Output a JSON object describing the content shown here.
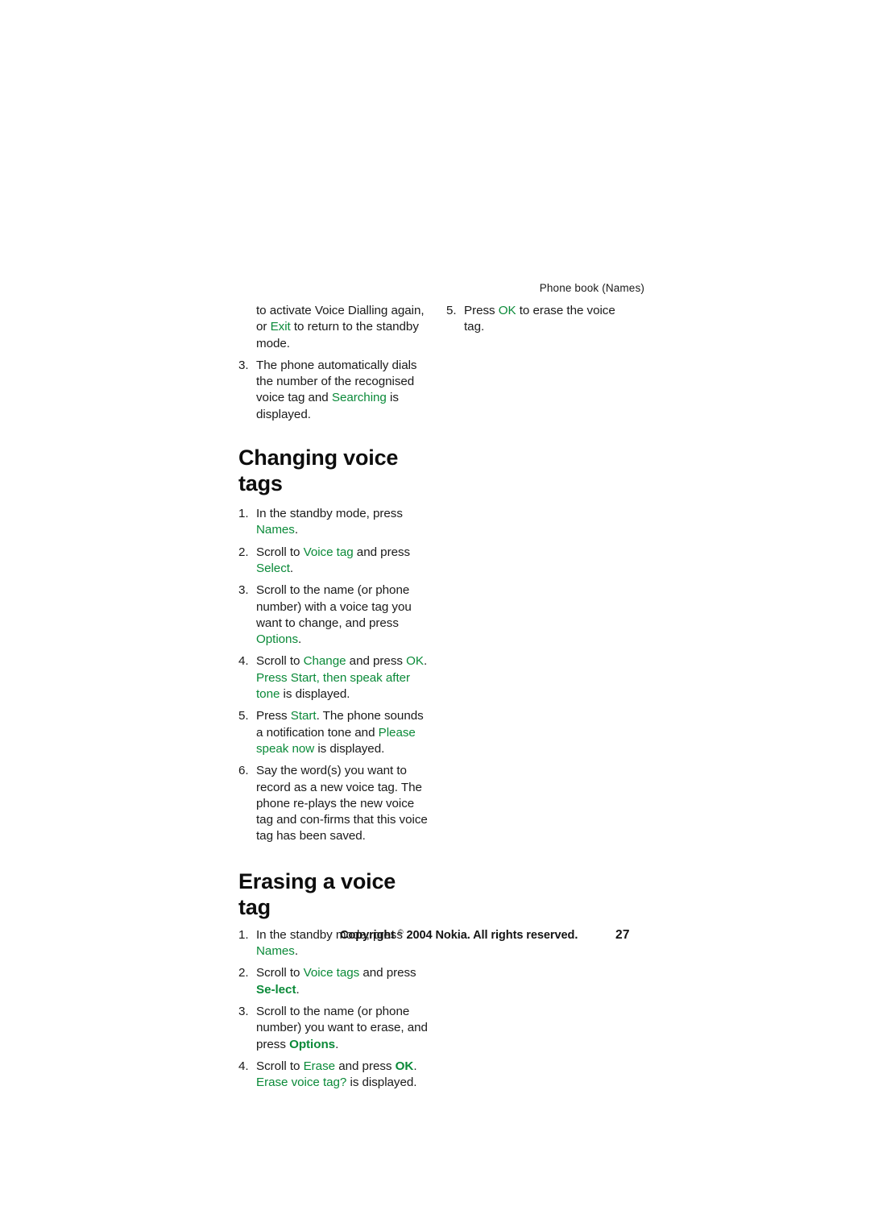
{
  "document": {
    "running_header": "Phone book (Names)",
    "page_number": "27"
  },
  "footer": {
    "copyright_prefix": "Copyright ",
    "copyright_symbol": "©",
    "copyright_suffix": " 2004 Nokia. All rights reserved."
  },
  "left_column": {
    "continuation": {
      "part1": "to activate Voice Dialling again, or ",
      "ui1": "Exit",
      "part2": " to return to the standby mode."
    },
    "step3": {
      "num": "3.",
      "part1": "The phone automatically dials the number of the recognised voice tag and ",
      "ui1": "Searching",
      "part2": " is displayed."
    },
    "sections": [
      {
        "heading": "Changing voice tags",
        "steps": [
          {
            "num": "1.",
            "part1": "In the standby mode, press ",
            "ui1": "Names",
            "part2": "."
          },
          {
            "num": "2.",
            "part1": "Scroll to ",
            "ui1": "Voice tag",
            "part2": " and press ",
            "ui2": "Select",
            "part3": "."
          },
          {
            "num": "3.",
            "part1": "Scroll to the name (or phone number) with a voice tag you want to change, and press ",
            "ui1": "Options",
            "part2": "."
          },
          {
            "num": "4.",
            "part1": "Scroll to ",
            "ui1": "Change",
            "part2": " and press  ",
            "ui2": "OK",
            "part3": ". ",
            "ui3": "Press Start, then speak after tone",
            "part4": " is displayed."
          },
          {
            "num": "5.",
            "part1": "Press ",
            "ui1": "Start",
            "part2": ". The phone sounds a notification tone and ",
            "ui2": "Please speak now",
            "part3": " is displayed."
          },
          {
            "num": "6.",
            "part1": "Say the word(s) you want to record as a new voice tag. The phone re-plays the new voice tag and con-firms that this voice tag has been saved."
          }
        ]
      },
      {
        "heading": "Erasing a voice tag",
        "steps": [
          {
            "num": "1.",
            "part1": "In the standby mode, press ",
            "ui1": "Names",
            "part2": "."
          },
          {
            "num": "2.",
            "part1": "Scroll to ",
            "ui1": "Voice tags",
            "part2": " and press ",
            "ui2": "Se-lect",
            "part3": "."
          },
          {
            "num": "3.",
            "part1": "Scroll to the name (or phone number) you want to erase, and press ",
            "ui1": "Options",
            "part2": "."
          },
          {
            "num": "4.",
            "part1": "Scroll to ",
            "ui1": "Erase",
            "part2": " and press ",
            "ui2": "OK",
            "part3": ". ",
            "ui3": "Erase voice tag?",
            "part4": " is displayed."
          }
        ]
      }
    ]
  },
  "right_column": {
    "step5": {
      "num": "5.",
      "part1": "Press ",
      "ui1": "OK",
      "part2": " to erase the voice tag."
    }
  },
  "colors": {
    "ui_term_green": "#0b8a39",
    "body_text": "#1a1a1a",
    "page_background": "#ffffff"
  }
}
